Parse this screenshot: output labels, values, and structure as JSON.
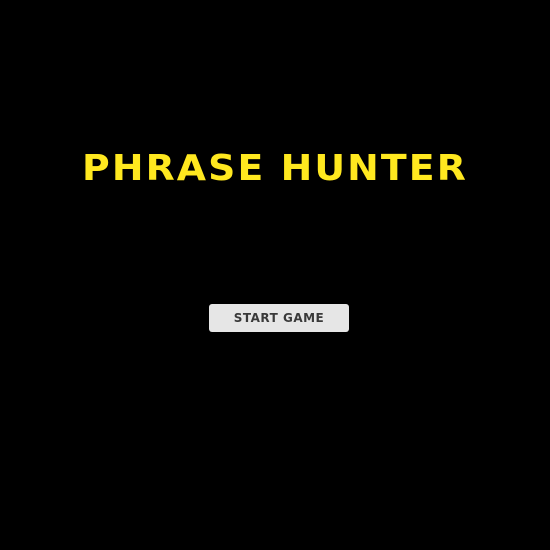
{
  "game": {
    "title": "PHRASE HUNTER",
    "start_button_label": "START GAME"
  },
  "colors": {
    "background": "#000000",
    "title": "#ffe81f",
    "button_bg": "#e6e6e6",
    "button_text": "#3a3a3a"
  }
}
